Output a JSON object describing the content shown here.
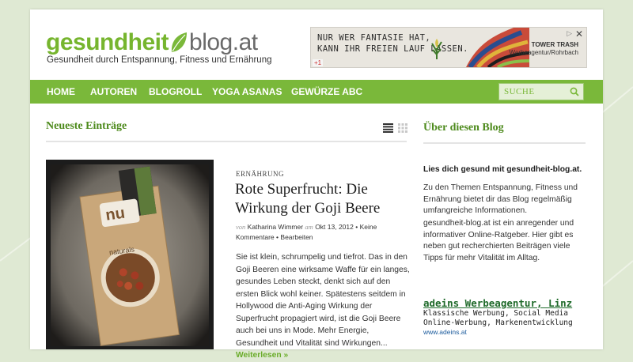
{
  "logo": {
    "part_a": "gesundheit",
    "part_b": "blog.at",
    "icon": "leaf-icon"
  },
  "tagline": "Gesundheit durch Entspannung, Fitness und Ernährung",
  "ad": {
    "line1": "NUR WER FANTASIE HAT,",
    "line2": "KANN IHR FREIEN LAUF LASSEN.",
    "brand": "TOWER TRASH",
    "agency": "Werbeagentur/Rohrbach",
    "plus": "+1",
    "close": "✕",
    "arrow": "▷"
  },
  "nav": {
    "items": [
      {
        "label": "HOME"
      },
      {
        "label": "AUTOREN"
      },
      {
        "label": "BLOGROLL"
      },
      {
        "label": "YOGA ASANAS"
      },
      {
        "label": "GEWÜRZE ABC"
      }
    ],
    "search_placeholder": "SUCHE"
  },
  "main": {
    "section_title": "Neueste Einträge",
    "post": {
      "category": "ERNÄHRUNG",
      "title": "Rote Superfrucht: Die Wirkung der Goji Beere",
      "meta_von": "von",
      "author": "Katharina Wimmer",
      "meta_am": "am",
      "date": "Okt 13, 2012",
      "comments": "Keine Kommentare",
      "edit": "Bearbeiten",
      "sep": "•",
      "excerpt": "Sie ist klein, schrumpelig und tiefrot. Das in den Goji Beeren eine wirksame Waffe für ein langes, gesundes Leben steckt, denkt sich auf den ersten Blick wohl keiner. Spätestens seitdem in Hollywood die Anti-Aging Wirkung der Superfrucht propagiert wird, ist die Goji Beere auch bei uns in Mode. Mehr Energie, Gesundheit und Vitalität sind Wirkungen...",
      "read_more": "Weiterlesen »",
      "image_label_a": "nu",
      "image_label_b": "naturals"
    }
  },
  "sidebar": {
    "title": "Über diesen Blog",
    "intro": "Lies dich gesund mit gesundheit-blog.at.",
    "p1": "Zu den Themen Entspannung, Fitness und Ernährung bietet dir das Blog regelmäßig umfangreiche Informationen.",
    "p2": "gesundheit-blog.at ist ein anregender und informativer Online-Ratgeber. Hier gibt es neben gut recherchierten Beiträgen viele Tipps für mehr Vitalität im Alltag.",
    "promo": {
      "title": "adeins Werbeagentur, Linz",
      "line1": "Klassische Werbung, Social Media",
      "line2": "Online-Werbung, Markenentwicklung",
      "url": "www.adeins.at"
    }
  },
  "colors": {
    "brand_green": "#7ab83a",
    "heading_green": "#4d8a1c",
    "background": "#dfe9d3"
  }
}
